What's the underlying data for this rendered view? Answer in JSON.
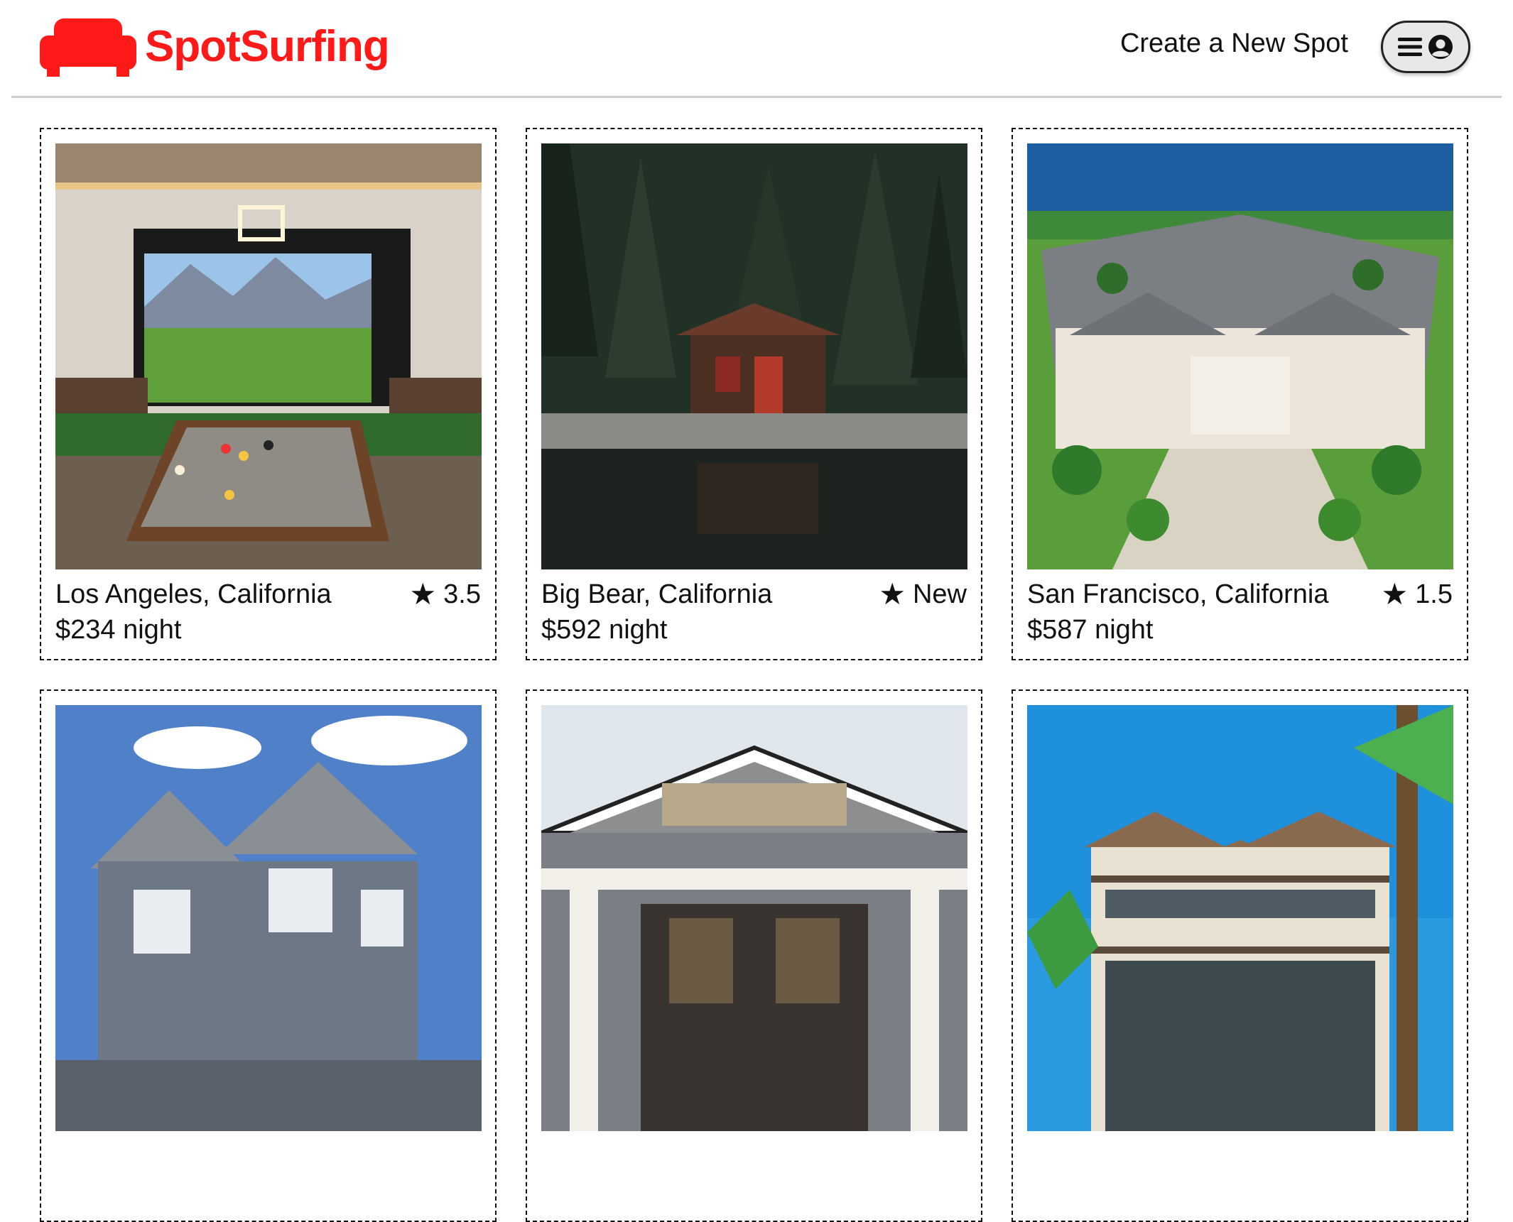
{
  "brand": {
    "name": "SpotSurfing",
    "color": "#ff1a1a",
    "icon": "sofa-icon"
  },
  "nav": {
    "create_spot_label": "Create a New Spot",
    "menu_icon": "hamburger-icon",
    "profile_icon": "user-circle-icon"
  },
  "spots": [
    {
      "location": "Los Angeles, California",
      "rating": "3.5",
      "price": "$234 night",
      "image": "golf-simulator-room"
    },
    {
      "location": "Big Bear, California",
      "rating": "New",
      "price": "$592 night",
      "image": "lakeside-cabin"
    },
    {
      "location": "San Francisco, California",
      "rating": "1.5",
      "price": "$587 night",
      "image": "waterfront-mansion"
    },
    {
      "location": "",
      "rating": "",
      "price": "",
      "image": "gray-suburban-house"
    },
    {
      "location": "",
      "rating": "",
      "price": "",
      "image": "craftsman-bungalow"
    },
    {
      "location": "",
      "rating": "",
      "price": "",
      "image": "tropical-villa"
    }
  ]
}
